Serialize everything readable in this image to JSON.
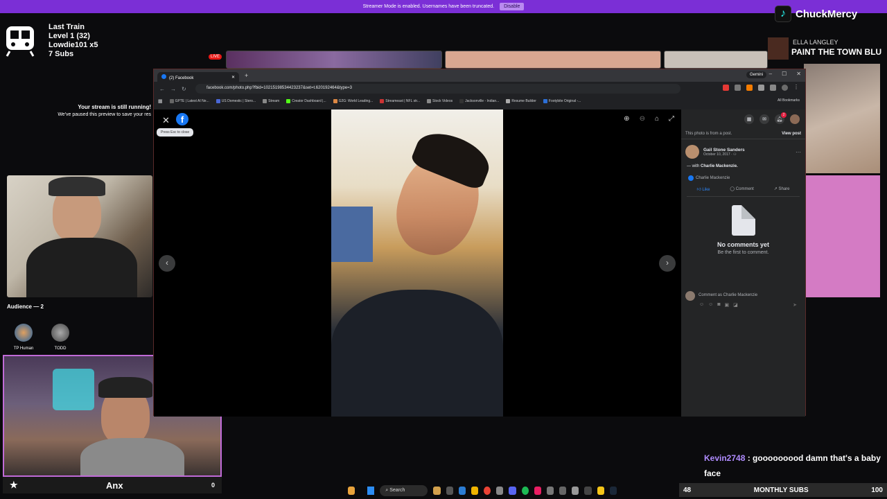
{
  "streamer_bar": {
    "message": "Streamer Mode is enabled. Usernames have been truncated.",
    "button": "Disable"
  },
  "overlay": {
    "line1": "Last Train",
    "line2": "Level 1  (32)",
    "line3": "Lowdie101 x5",
    "line4": "7 Subs",
    "live": "LIVE",
    "stream_running_title": "Your stream is still running!",
    "stream_running_sub": "We've paused this preview to save your res"
  },
  "audience": {
    "label": "Audience — 2",
    "members": [
      "TP Human",
      "TODD"
    ]
  },
  "main_cam": {
    "name": "Anx",
    "count": "0"
  },
  "tiktok": {
    "handle": "ChuckMercy"
  },
  "song": {
    "artist": "ELLA LANGLEY",
    "title": "PAINT THE TOWN BLU"
  },
  "chat": {
    "user": "Kevin2748",
    "message": ": gooooooood damn that's a baby face"
  },
  "subs_bar": {
    "count": "48",
    "label": "MONTHLY SUBS",
    "volume": "100"
  },
  "browser": {
    "tab_title": "(2) Facebook",
    "gemini": "Gemini",
    "url": "facebook.com/photo.php?fbid=10215198534423237&set=t.620192464&type=3",
    "bookmarks": [
      "GPTE | Latest AI Ne...",
      "US Domestic | Stero...",
      "Stream",
      "Creator Dashboard |...",
      "G2G: World Leading...",
      "Streameast | NFL str...",
      "Stock Videos",
      "Jacksonville - Indian...",
      "Resume Builder",
      "Footybite Original -..."
    ],
    "all_bookmarks": "All Bookmarks"
  },
  "viewer": {
    "esc_tip": "Press Esc to close",
    "prev": "‹",
    "next": "›"
  },
  "panel": {
    "notification_count": "2",
    "post_note": "This photo is from a post.",
    "view_post": "View post",
    "author": "Gail Stone Sanders",
    "date": "October 10, 2017 · ⚇",
    "with_prefix": "— with",
    "with_name": "Charlie Mackenzie.",
    "reactor": "Charlie Mackenzie",
    "like": "Like",
    "comment": "Comment",
    "share": "Share",
    "no_comments": "No comments yet",
    "be_first": "Be the first to comment.",
    "comment_placeholder": "Comment as Charlie Mackenzie"
  },
  "taskbar": {
    "search": "Search"
  }
}
